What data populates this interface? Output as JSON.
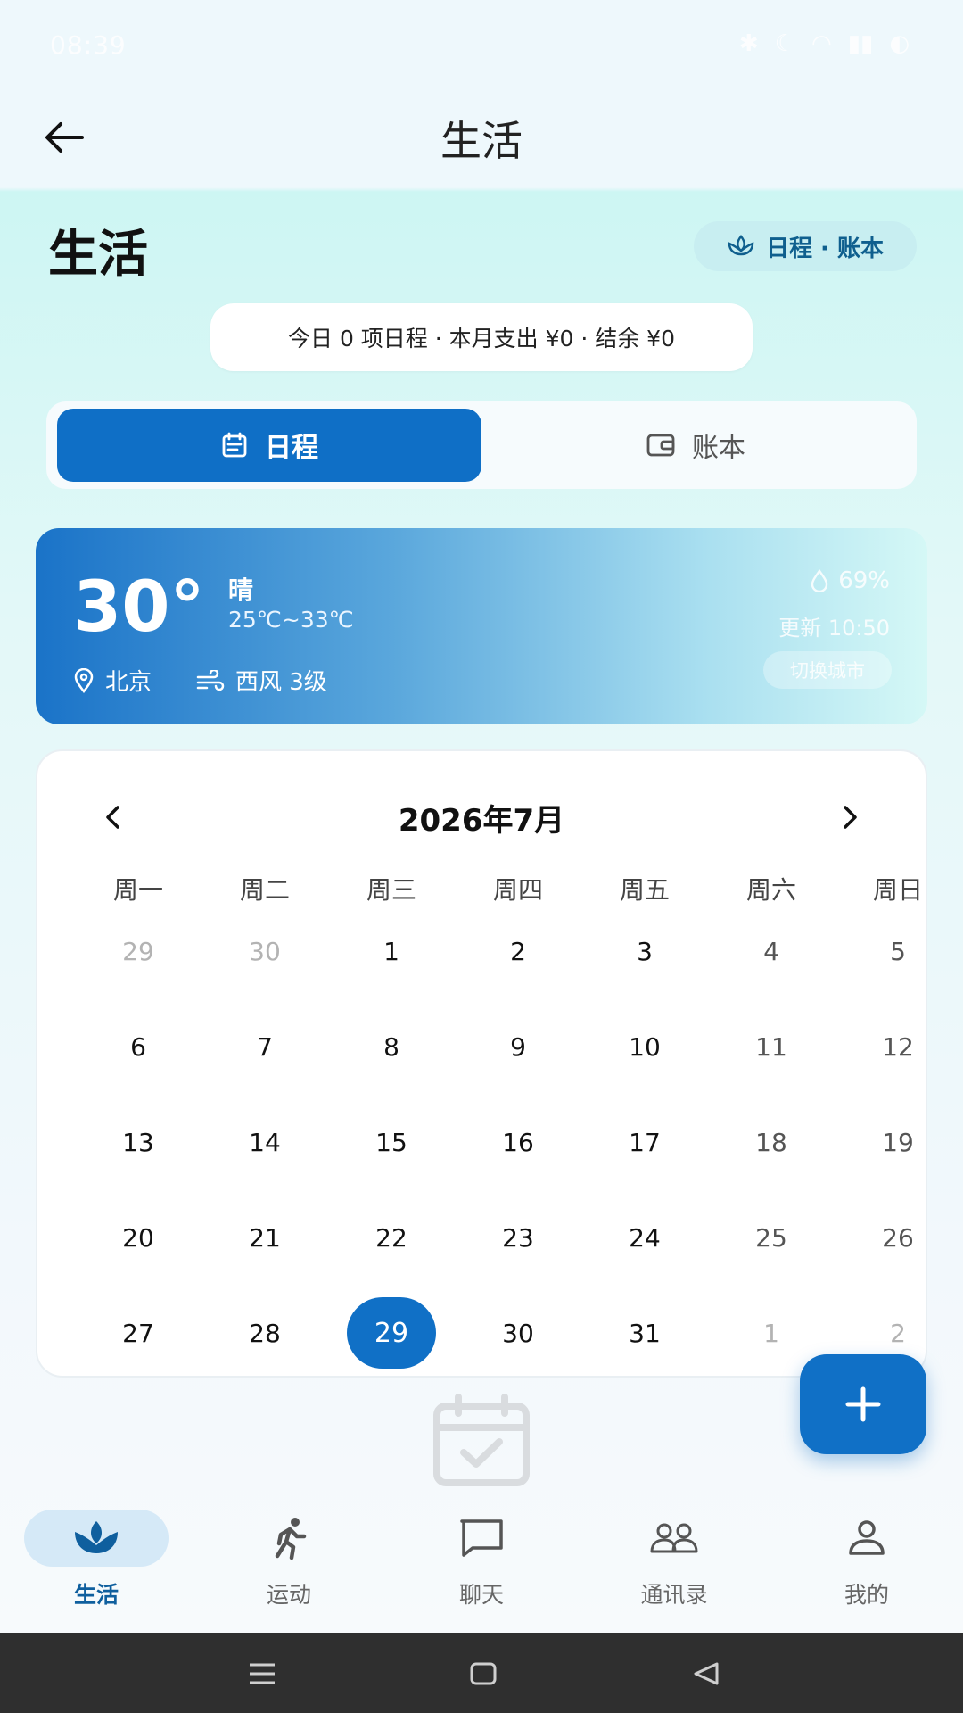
{
  "status_bar": {
    "time": "08:39"
  },
  "app_bar": {
    "title": "生活"
  },
  "header": {
    "title": "生活",
    "badge": "日程 · 账本",
    "summary": "今日 0 项日程 · 本月支出 ¥0 · 结余 ¥0"
  },
  "segments": [
    {
      "label": "日程",
      "icon": "calendar-icon",
      "active": true
    },
    {
      "label": "账本",
      "icon": "wallet-icon",
      "active": false
    }
  ],
  "weather": {
    "temperature": "30°",
    "condition": "晴",
    "range": "25℃~33℃",
    "location": "北京",
    "wind": "西风 3级",
    "humidity": "69%",
    "updated": "更新 10:50",
    "switch_city": "切换城市"
  },
  "calendar": {
    "month_label": "2026年7月",
    "weekdays": [
      "周一",
      "周二",
      "周三",
      "周四",
      "周五",
      "周六",
      "周日"
    ],
    "weeks": [
      [
        "29",
        "30",
        "1",
        "2",
        "3",
        "4",
        "5"
      ],
      [
        "6",
        "7",
        "8",
        "9",
        "10",
        "11",
        "12"
      ],
      [
        "13",
        "14",
        "15",
        "16",
        "17",
        "18",
        "19"
      ],
      [
        "20",
        "21",
        "22",
        "23",
        "24",
        "25",
        "26"
      ],
      [
        "27",
        "28",
        "29",
        "30",
        "31",
        "1",
        "2"
      ]
    ],
    "selected_day": "29"
  },
  "bottom_nav": [
    {
      "label": "生活",
      "icon": "lotus-icon",
      "active": true
    },
    {
      "label": "运动",
      "icon": "running-icon",
      "active": false
    },
    {
      "label": "聊天",
      "icon": "chat-icon",
      "active": false
    },
    {
      "label": "通讯录",
      "icon": "contacts-icon",
      "active": false
    },
    {
      "label": "我的",
      "icon": "profile-icon",
      "active": false
    }
  ],
  "colors": {
    "primary": "#1070c6",
    "accent_light": "#c8eef1"
  }
}
